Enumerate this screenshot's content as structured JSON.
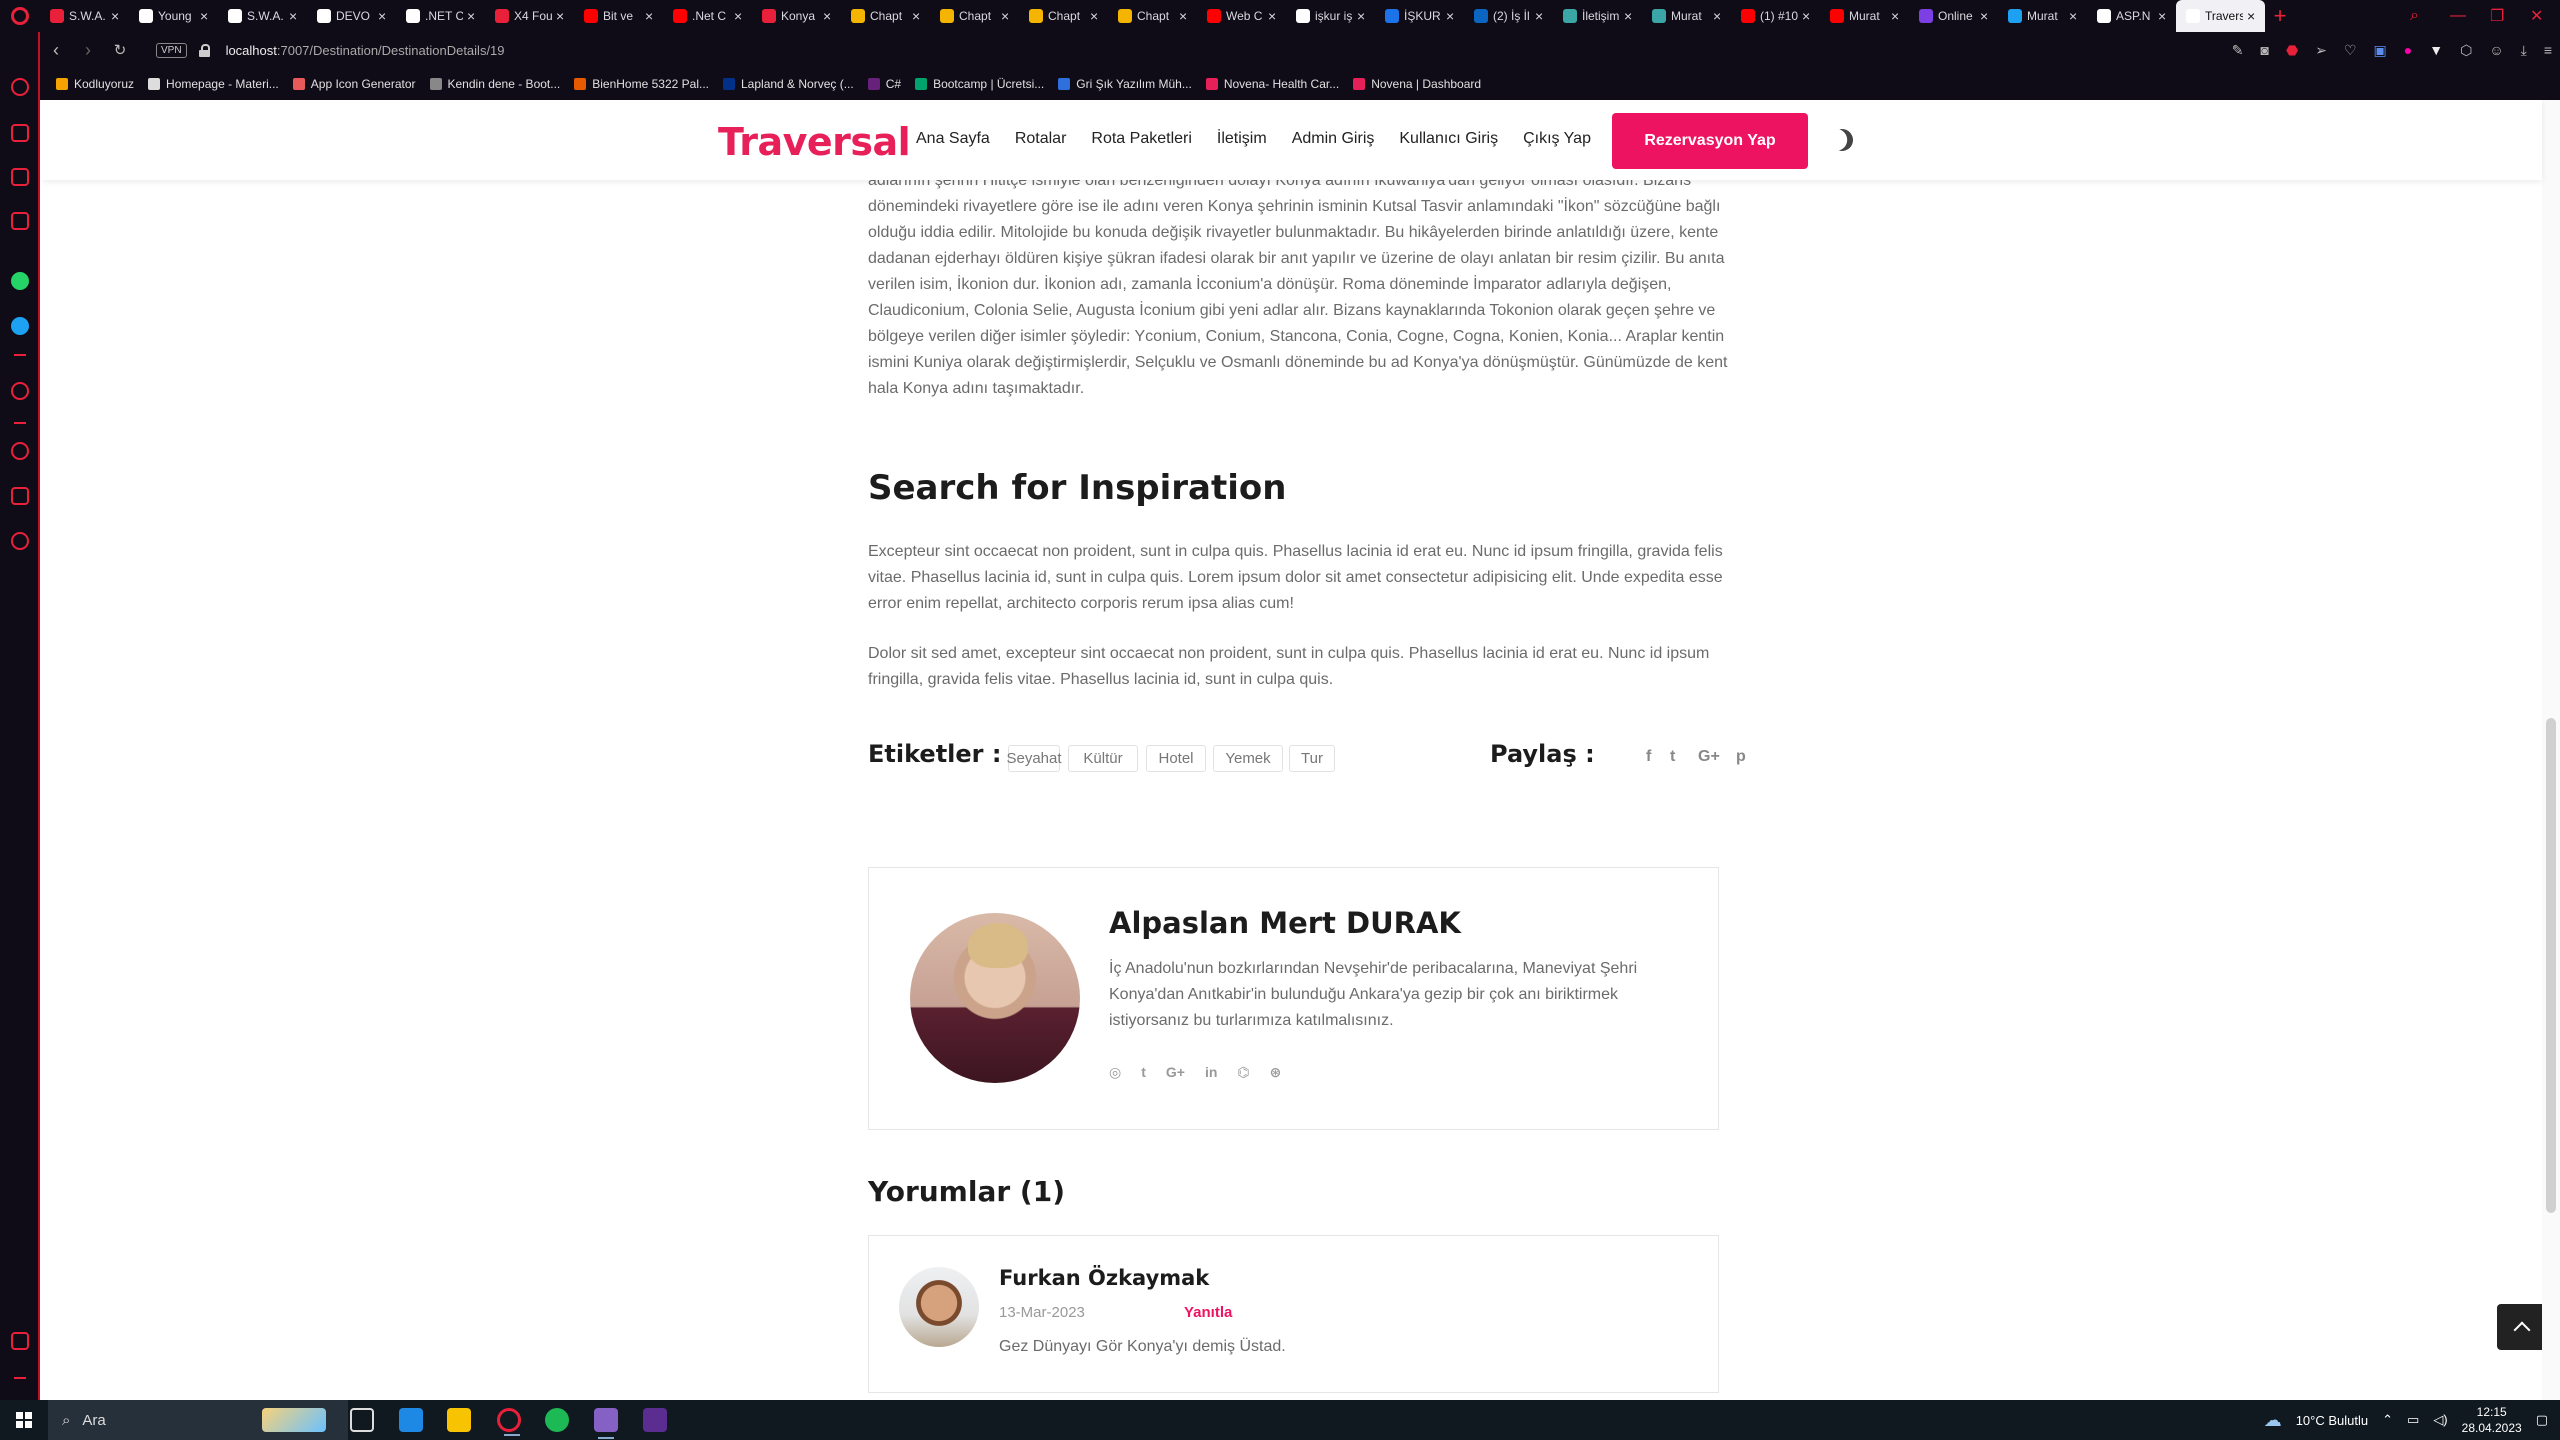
{
  "browser": {
    "tabs": [
      {
        "label": "S.W.A.",
        "color": "#e8203a"
      },
      {
        "label": "Young",
        "color": "#ffffff"
      },
      {
        "label": "S.W.A.",
        "color": "#ffffff"
      },
      {
        "label": "DEVO",
        "color": "#ffffff"
      },
      {
        "label": ".NET C",
        "color": "#ffffff"
      },
      {
        "label": "X4 Fou",
        "color": "#e8203a"
      },
      {
        "label": "Bit ve",
        "color": "#ff0000"
      },
      {
        "label": ".Net C",
        "color": "#ff0000"
      },
      {
        "label": "Konya",
        "color": "#e8203a"
      },
      {
        "label": "Chapt",
        "color": "#f4b400"
      },
      {
        "label": "Chapt",
        "color": "#f4b400"
      },
      {
        "label": "Chapt",
        "color": "#f4b400"
      },
      {
        "label": "Chapt",
        "color": "#f4b400"
      },
      {
        "label": "Web C",
        "color": "#ff0000"
      },
      {
        "label": "işkur iş",
        "color": "#ffffff"
      },
      {
        "label": "İŞKUR",
        "color": "#1a73e8"
      },
      {
        "label": "(2) İş İl",
        "color": "#0a66c2"
      },
      {
        "label": "İletişim",
        "color": "#3aa6a6"
      },
      {
        "label": "Murat",
        "color": "#3aa6a6"
      },
      {
        "label": "(1) #10",
        "color": "#ff0000"
      },
      {
        "label": "Murat",
        "color": "#ff0000"
      },
      {
        "label": "Online",
        "color": "#7b3fe4"
      },
      {
        "label": "Murat",
        "color": "#1da1f2"
      },
      {
        "label": "ASP.N",
        "color": "#ffffff"
      },
      {
        "label": "Travers",
        "color": "#ffffff",
        "active": true
      }
    ],
    "url_host": "localhost",
    "url_path": ":7007/Destination/DestinationDetails/19",
    "vpn": "VPN",
    "bookmarks": [
      {
        "label": "Kodluyoruz",
        "color": "#f4a300"
      },
      {
        "label": "Homepage - Materi...",
        "color": "#dddddd"
      },
      {
        "label": "App Icon Generator",
        "color": "#e85a5a"
      },
      {
        "label": "Kendin dene - Boot...",
        "color": "#888888"
      },
      {
        "label": "BienHome 5322 Pal...",
        "color": "#e85a00"
      },
      {
        "label": "Lapland & Norveç (...",
        "color": "#003087"
      },
      {
        "label": "C#",
        "color": "#68217a"
      },
      {
        "label": "Bootcamp | Ücretsi...",
        "color": "#00a36c"
      },
      {
        "label": "Gri Şık Yazılım Müh...",
        "color": "#2f6fdb"
      },
      {
        "label": "Novena- Health Car...",
        "color": "#e8205a"
      },
      {
        "label": "Novena | Dashboard",
        "color": "#e8205a"
      }
    ]
  },
  "site": {
    "logo": "Traversal",
    "menu": [
      "Ana Sayfa",
      "Rotalar",
      "Rota Paketleri",
      "İletişim",
      "Admin Giriş",
      "Kullanıcı Giriş",
      "Çıkış Yap"
    ],
    "cta": "Rezervasyon Yap",
    "accent": "#ee1360"
  },
  "article": {
    "intro_lines": [
      "adlarının şehrin Hititçe ismiyle olan benzerliğinden dolayı Konya adının İkuwaniya'dan geliyor olması olasıdır. Bizans",
      "dönemindeki rivayetlere göre ise ile adını veren Konya şehrinin isminin Kutsal Tasvir anlamındaki \"İkon\" sözcüğüne bağlı",
      "olduğu iddia edilir. Mitolojide bu konuda değişik rivayetler bulunmaktadır. Bu hikâyelerden birinde anlatıldığı üzere, kente",
      "dadanan ejderhayı öldüren kişiye şükran ifadesi olarak bir anıt yapılır ve üzerine de olayı anlatan bir resim çizilir. Bu anıta",
      "verilen isim, İkonion dur. İkonion adı, zamanla İcconium'a dönüşür. Roma döneminde İmparator adlarıyla değişen,",
      "Claudiconium, Colonia Selie, Augusta İconium gibi yeni adlar alır. Bizans kaynaklarında Tokonion olarak geçen şehre ve",
      "bölgeye verilen diğer isimler şöyledir: Yconium, Conium, Stancona, Conia, Cogne, Cogna, Konien, Konia... Araplar kentin",
      "ismini Kuniya olarak değiştirmişlerdir, Selçuklu ve Osmanlı döneminde bu ad Konya'ya dönüşmüştür. Günümüzde de kent",
      "hala Konya adını taşımaktadır."
    ],
    "heading": "Search for Inspiration",
    "paragraph1_lines": [
      "Excepteur sint occaecat non proident, sunt in culpa quis. Phasellus lacinia id erat eu. Nunc id ipsum fringilla, gravida felis",
      "vitae. Phasellus lacinia id, sunt in culpa quis. Lorem ipsum dolor sit amet consectetur adipisicing elit. Unde expedita esse",
      "error enim repellat, architecto corporis rerum ipsa alias cum!"
    ],
    "paragraph2_lines": [
      "Dolor sit sed amet, excepteur sint occaecat non proident, sunt in culpa quis. Phasellus lacinia id erat eu. Nunc id ipsum",
      "fringilla, gravida felis vitae. Phasellus lacinia id, sunt in culpa quis."
    ],
    "tags_label": "Etiketler :",
    "tags": [
      "Seyahat",
      "Kültür",
      "Hotel",
      "Yemek",
      "Tur"
    ],
    "share_label": "Paylaş :",
    "share_icons": [
      "f",
      "t",
      "G+",
      "p"
    ]
  },
  "author": {
    "name": "Alpaslan Mert DURAK",
    "bio_lines": [
      "İç Anadolu'nun bozkırlarından Nevşehir'de peribacalarına, Maneviyat Şehri",
      "Konya'dan Anıtkabir'in bulunduğu Ankara'ya gezip bir çok anı biriktirmek",
      "istiyorsanız bu turlarımıza katılmalısınız."
    ],
    "social": [
      "◎",
      "t",
      "G+",
      "in",
      "⌬",
      "⊛"
    ]
  },
  "comments": {
    "title": "Yorumlar (1)",
    "items": [
      {
        "name": "Furkan Özkaymak",
        "date": "13-Mar-2023",
        "reply": "Yanıtla",
        "text": "Gez Dünyayı Gör Konya'yı demiş Üstad."
      }
    ]
  },
  "taskbar": {
    "search": "Ara",
    "weather": "10°C  Bulutlu",
    "time": "12:15",
    "date": "28.04.2023"
  }
}
